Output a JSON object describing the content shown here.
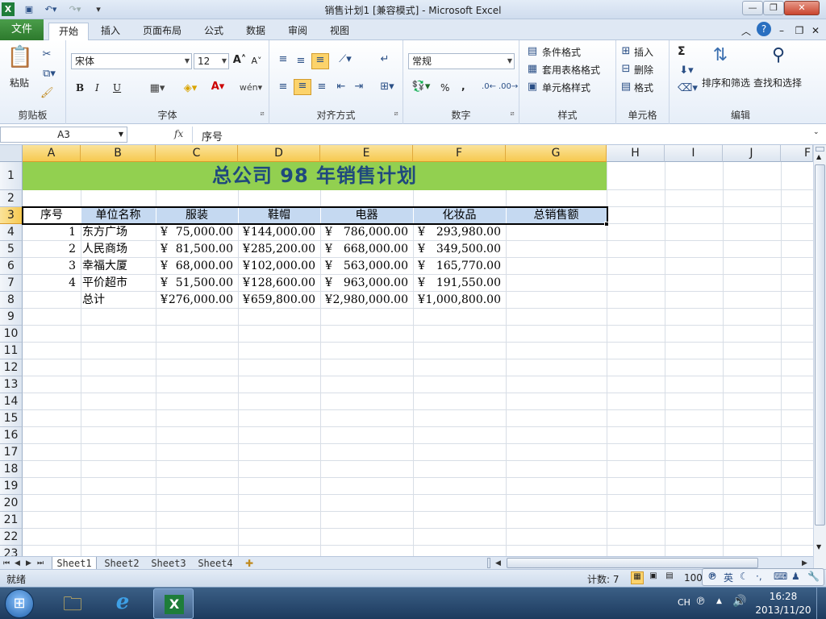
{
  "window": {
    "title": "销售计划1 [兼容模式] - Microsoft Excel"
  },
  "tabs": [
    "文件",
    "开始",
    "插入",
    "页面布局",
    "公式",
    "数据",
    "审阅",
    "视图"
  ],
  "ribbon": {
    "clipboard": {
      "label": "剪贴板",
      "paste": "粘贴"
    },
    "font": {
      "label": "字体",
      "name": "宋体",
      "size": "12",
      "bold": "B",
      "italic": "I",
      "underline": "U"
    },
    "alignment": {
      "label": "对齐方式"
    },
    "number": {
      "label": "数字",
      "format": "常规",
      "percent": "%",
      "comma": ","
    },
    "styles": {
      "label": "样式",
      "conditional": "条件格式",
      "table": "套用表格格式",
      "cell": "单元格样式"
    },
    "cells": {
      "label": "单元格",
      "insert": "插入",
      "delete": "删除",
      "format": "格式"
    },
    "editing": {
      "label": "编辑",
      "sort": "排序和筛选",
      "find": "查找和选择",
      "sum": "Σ"
    }
  },
  "formula_bar": {
    "name_box": "A3",
    "fx": "fx",
    "content": "序号"
  },
  "columns": [
    "A",
    "B",
    "C",
    "D",
    "E",
    "F",
    "G",
    "H",
    "I",
    "J",
    "F"
  ],
  "rows": [
    "1",
    "2",
    "3",
    "4",
    "5",
    "6",
    "7",
    "8",
    "9",
    "10",
    "11",
    "12",
    "13",
    "14",
    "15",
    "16",
    "17",
    "18",
    "19",
    "20",
    "21",
    "22",
    "23"
  ],
  "sheet": {
    "title": "总公司  98  年销售计划",
    "headers": [
      "序号",
      "单位名称",
      "服装",
      "鞋帽",
      "电器",
      "化妆品",
      "总销售额"
    ],
    "currency": "¥",
    "data": [
      {
        "no": "1",
        "unit": "东方广场",
        "c": "75,000.00",
        "d": "144,000.00",
        "e": "786,000.00",
        "f": "293,980.00"
      },
      {
        "no": "2",
        "unit": "人民商场",
        "c": "81,500.00",
        "d": "285,200.00",
        "e": "668,000.00",
        "f": "349,500.00"
      },
      {
        "no": "3",
        "unit": "幸福大厦",
        "c": "68,000.00",
        "d": "102,000.00",
        "e": "563,000.00",
        "f": "165,770.00"
      },
      {
        "no": "4",
        "unit": "平价超市",
        "c": "51,500.00",
        "d": "128,600.00",
        "e": "963,000.00",
        "f": "191,550.00"
      }
    ],
    "total": {
      "label": "总计",
      "c": "276,000.00",
      "d": "659,800.00",
      "e": "2,980,000.00",
      "f": "1,000,800.00"
    }
  },
  "sheet_tabs": [
    "Sheet1",
    "Sheet2",
    "Sheet3",
    "Sheet4"
  ],
  "status": {
    "ready": "就绪",
    "count": "计数: 7",
    "zoom": "100"
  },
  "taskbar": {
    "ime": "英",
    "lang": "CH",
    "time": "16:28",
    "date": "2013/11/20"
  },
  "colors": {
    "title_fill": "#92d050",
    "title_text": "#1f497d",
    "header_fill": "#c5d9f1",
    "file_tab": "#2d7a2d"
  }
}
